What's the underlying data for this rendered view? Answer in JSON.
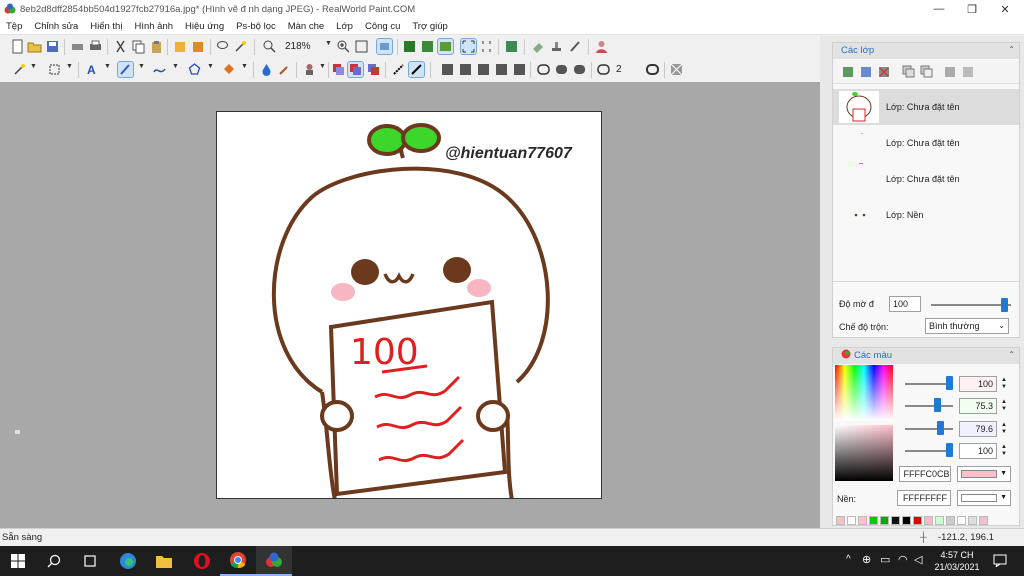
{
  "window": {
    "title": "8eb2d8dff2854bb504d1927fcb27916a.jpg* (Hình vẽ đ nh dạng JPEG) - RealWorld Paint.COM",
    "controls": {
      "minimize": "—",
      "maximize": "❐",
      "close": "✕"
    }
  },
  "menu": [
    "Tệp",
    "Chỉnh sửa",
    "Hiển thị",
    "Hình ảnh",
    "Hiệu ứng",
    "Ps-bộ lọc",
    "Màn che",
    "Lớp",
    "Công cụ",
    "Trợ giúp"
  ],
  "toolbar": {
    "zoom": "218%",
    "brush_size": "2"
  },
  "canvas": {
    "watermark": "@hientuan77607",
    "doodle_text": "100",
    "colors": {
      "outline": "#6b3a1e",
      "leaf": "#3dd62a",
      "cheek": "#f7b6c2",
      "ink": "#e02020"
    }
  },
  "layers_panel": {
    "title": "Các lớp",
    "layers": [
      {
        "name": "Lớp: Chưa đặt tên",
        "selected": true
      },
      {
        "name": "Lớp: Chưa đặt tên",
        "selected": false
      },
      {
        "name": "Lớp: Chưa đặt tên",
        "selected": false
      },
      {
        "name": "Lớp: Nền",
        "selected": false
      }
    ],
    "opacity_label": "Độ mờ đ",
    "opacity_value": "100",
    "blend_label": "Chế độ trộn:",
    "blend_value": "Bình thường"
  },
  "colors_panel": {
    "title": "Các màu",
    "channels": [
      "100",
      "75.3",
      "79.6",
      "100"
    ],
    "primary_hex": "FFFFC0CB",
    "secondary_label": "Nền:",
    "secondary_hex": "FFFFFFFF",
    "primary_color": "#ffc0cb",
    "secondary_color": "#ffffff",
    "palette": [
      "#f4c2c2",
      "#ffffff",
      "#ffc0cb",
      "#00cc00",
      "#00aa00",
      "#111111",
      "#000000",
      "#e00000",
      "#ffb6c1",
      "#ccffcc",
      "#cccccc",
      "#ffffff",
      "#dddddd",
      "#f0c0d0"
    ]
  },
  "statusbar": {
    "text": "Sẵn sàng",
    "coords": "-121.2, 196.1"
  },
  "taskbar": {
    "time": "4:57 CH",
    "date": "21/03/2021"
  }
}
